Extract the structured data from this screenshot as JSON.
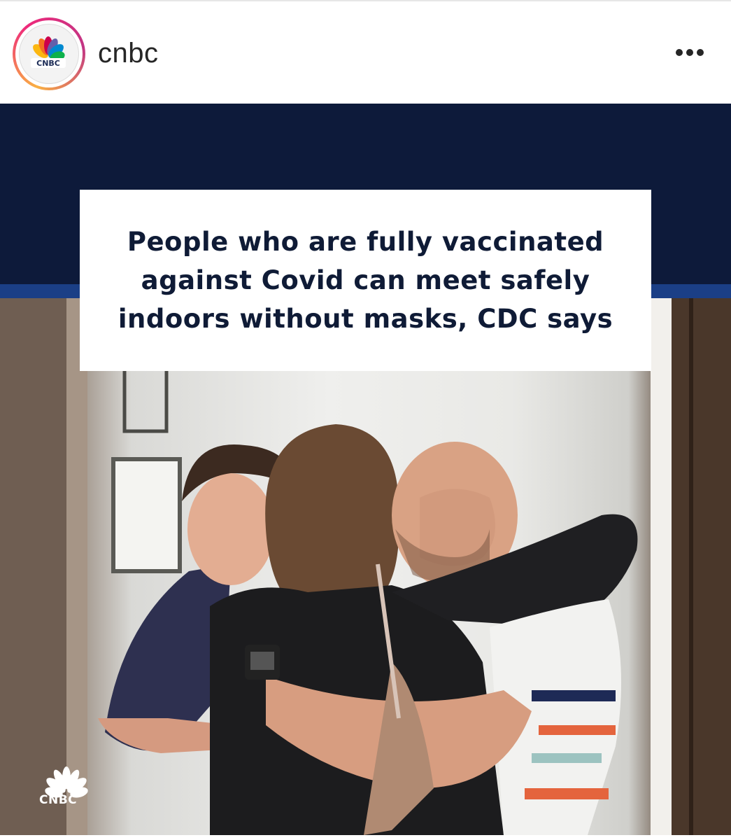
{
  "post": {
    "username": "cnbc",
    "avatar_logo_text": "CNBC",
    "more_icon": "more-horizontal-icon"
  },
  "image": {
    "headline": "People who are fully vaccinated against Covid can meet safely indoors without masks, CDC says",
    "watermark_text": "CNBC",
    "colors": {
      "navy": "#0d1a3a",
      "stripe_blue": "#1b3f86",
      "headline_text": "#0f1b36"
    }
  }
}
